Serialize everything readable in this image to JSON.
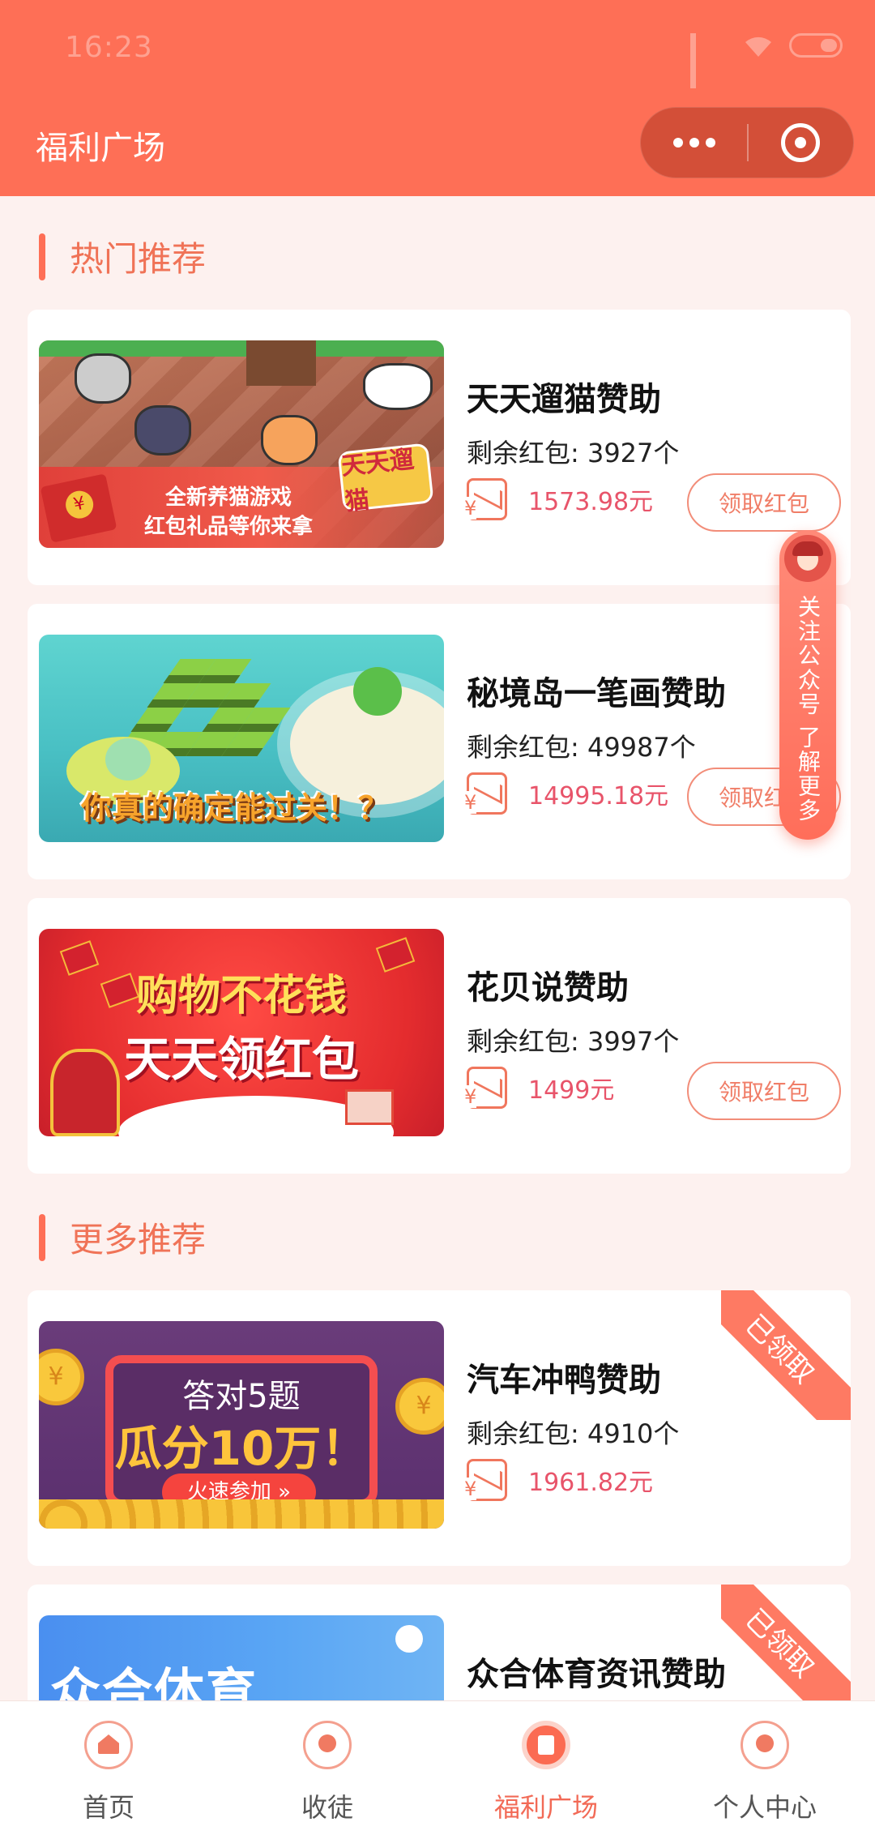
{
  "status_bar": {
    "time": "16:23"
  },
  "header": {
    "title": "福利广场"
  },
  "sections": {
    "hot": {
      "title": "热门推荐"
    },
    "more": {
      "title": "更多推荐"
    }
  },
  "hot_cards": [
    {
      "name": "天天遛猫赞助",
      "remaining": "剩余红包: 3927个",
      "amount": "1573.98元",
      "button": "领取红包",
      "thumb_text": [
        "全新养猫游戏",
        "红包礼品等你来拿"
      ],
      "thumb_logo": "天天遛猫"
    },
    {
      "name": "秘境岛一笔画赞助",
      "remaining": "剩余红包: 49987个",
      "amount": "14995.18元",
      "button": "领取红包",
      "thumb_text": [
        "你真的确定能过关！？"
      ]
    },
    {
      "name": "花贝说赞助",
      "remaining": "剩余红包: 3997个",
      "amount": "1499元",
      "button": "领取红包",
      "thumb_text": [
        "购物不花钱",
        "天天领红包"
      ]
    }
  ],
  "more_cards": [
    {
      "name": "汽车冲鸭赞助",
      "remaining": "剩余红包: 4910个",
      "amount": "1961.82元",
      "badge": "已领取",
      "thumb_text": [
        "答对5题",
        "瓜分10万！",
        "火速参加 »"
      ]
    },
    {
      "name": "众合体育资讯赞助",
      "badge": "已领取",
      "thumb_text": [
        "众合体育"
      ]
    }
  ],
  "float_widget": {
    "text": "关注公众号 了解更多"
  },
  "tabbar": {
    "items": [
      {
        "label": "首页",
        "icon": "home-icon"
      },
      {
        "label": "收徒",
        "icon": "add-user-icon"
      },
      {
        "label": "福利广场",
        "icon": "red-packet-icon",
        "active": true
      },
      {
        "label": "个人中心",
        "icon": "user-icon"
      }
    ]
  },
  "colors": {
    "accent": "#fe6f56",
    "amount": "#e8546a",
    "background": "#fdf1ef"
  }
}
